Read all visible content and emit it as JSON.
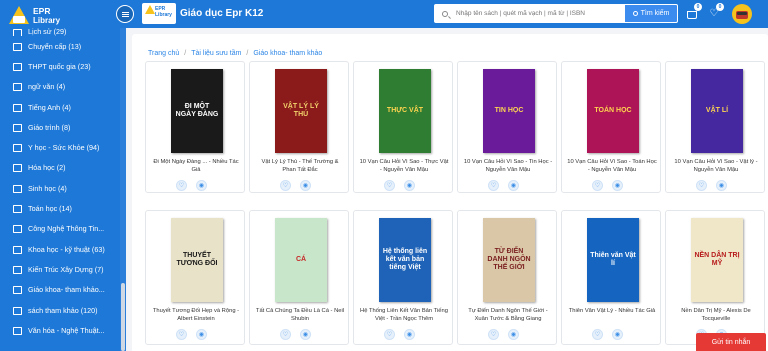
{
  "sidebar": {
    "logo_line1": "EPR",
    "logo_line2": "Library",
    "items": [
      {
        "label": "Lịch sử (29)"
      },
      {
        "label": "Chuyển cấp (13)"
      },
      {
        "label": "THPT quốc gia (23)"
      },
      {
        "label": "ngữ văn (4)"
      },
      {
        "label": "Tiếng Anh (4)"
      },
      {
        "label": "Giáo trình (8)"
      },
      {
        "label": "Y học - Sức Khỏe (94)"
      },
      {
        "label": "Hóa học (2)"
      },
      {
        "label": "Sinh học (4)"
      },
      {
        "label": "Toán học (14)"
      },
      {
        "label": "Công Nghệ Thông Tin..."
      },
      {
        "label": "Khoa học - kỹ thuật (63)"
      },
      {
        "label": "Kiến Trúc Xây Dựng (7)"
      },
      {
        "label": "Giáo khoa- tham khảo..."
      },
      {
        "label": "sách tham khảo (120)"
      },
      {
        "label": "Văn hóa - Nghệ Thuật..."
      }
    ]
  },
  "header": {
    "mini_logo": "EPR Library",
    "title": "Giáo dục Epr K12",
    "search_placeholder": "Nhập tên sách | quét mã vạch | mã từ | ISBN",
    "search_button": "Tìm kiếm",
    "cart_count": "0",
    "wishlist_count": "0"
  },
  "breadcrumb": {
    "home": "Trang chủ",
    "level1": "Tài liệu sưu tầm",
    "level2": "Giáo khoa- tham khảo",
    "separator": "/"
  },
  "books_row1": [
    {
      "title": "Đi Một Ngày Đàng ... - Nhiều Tác Giả",
      "cover_text": "ĐI MỘT NGÀY ĐÀNG",
      "cover_bg": "#1a1a1a",
      "cover_fg": "#ffffff"
    },
    {
      "title": "Vật Lý Lý Thú - Thế Trường &amp; Phan Tất Đắc",
      "cover_text": "VẬT LÝ LÝ THÚ",
      "cover_bg": "#8b1a1a",
      "cover_fg": "#f1d36b"
    },
    {
      "title": "10 Vạn Câu Hỏi Vì Sao - Thực Vật - Nguyễn Văn Mậu",
      "cover_text": "THỰC VẬT",
      "cover_bg": "#2e7d32",
      "cover_fg": "#ffd54f"
    },
    {
      "title": "10 Vạn Câu Hỏi Vì Sao - Tin Học - Nguyễn Văn Mậu",
      "cover_text": "TIN HỌC",
      "cover_bg": "#6a1b9a",
      "cover_fg": "#ffd54f"
    },
    {
      "title": "10 Vạn Câu Hỏi Vì Sao - Toán Học - Nguyễn Văn Mậu",
      "cover_text": "TOÁN HỌC",
      "cover_bg": "#ad1457",
      "cover_fg": "#ffd54f"
    },
    {
      "title": "10 Vạn Câu Hỏi Vì Sao - Vật lý - Nguyễn Văn Mậu",
      "cover_text": "VẬT LÍ",
      "cover_bg": "#4527a0",
      "cover_fg": "#ffd54f"
    }
  ],
  "books_row2": [
    {
      "title": "Thuyết Tương Đối Hẹp và Rộng - Albert Einstein",
      "cover_text": "THUYẾT TƯƠNG ĐỐI",
      "cover_bg": "#e8e2c8",
      "cover_fg": "#1a1a1a"
    },
    {
      "title": "Tất Cả Chúng Ta Đều Là Cá - Neil Shubin",
      "cover_text": "CÁ",
      "cover_bg": "#c8e6c9",
      "cover_fg": "#c62828"
    },
    {
      "title": "Hệ Thống Liên Kết Văn Bản Tiếng Việt - Trần Ngọc Thêm",
      "cover_text": "Hệ thống liên kết văn bản tiếng Việt",
      "cover_bg": "#1e63b8",
      "cover_fg": "#ffffff"
    },
    {
      "title": "Tự Điển Danh Ngôn Thế Giới - Xuân Tước &amp; Bằng Giang",
      "cover_text": "TỪ ĐIỂN DANH NGÔN THẾ GIỚI",
      "cover_bg": "#d9c7a8",
      "cover_fg": "#7b1f1f"
    },
    {
      "title": "Thiên Văn Vật Lý - Nhiều Tác Giả",
      "cover_text": "Thiên văn Vật lí",
      "cover_bg": "#1565c0",
      "cover_fg": "#ffffff"
    },
    {
      "title": "Nền Dân Trị Mỹ - Alexis De Tocqueville",
      "cover_text": "NỀN DÂN TRỊ MỸ",
      "cover_bg": "#f0e6c8",
      "cover_fg": "#b71c1c"
    }
  ],
  "chat_button": "Gửi tin nhắn"
}
